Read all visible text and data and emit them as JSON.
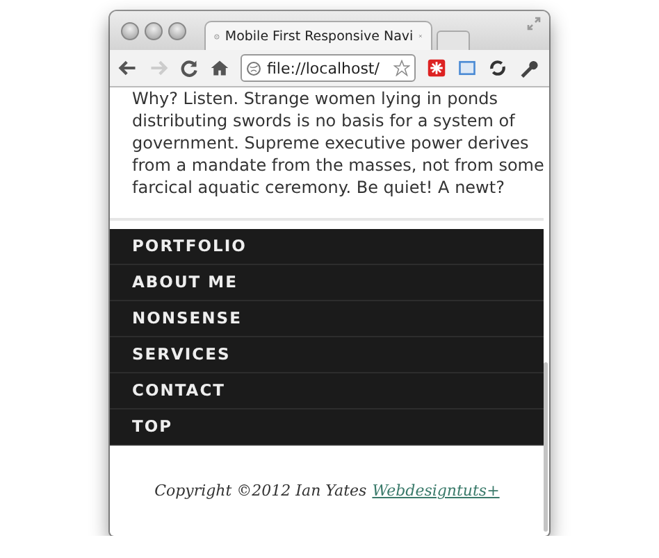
{
  "window": {
    "tab_title": "Mobile First Responsive Navi",
    "address": "file://localhost/"
  },
  "article": {
    "lines": [
      "Why? Listen. Strange women lying in ponds",
      "distributing swords is no basis for a system of",
      "government. Supreme executive power derives",
      "from a mandate from the masses, not from some",
      "farcical aquatic ceremony. Be quiet! A newt?"
    ]
  },
  "nav": {
    "items": [
      {
        "label": "PORTFOLIO"
      },
      {
        "label": "ABOUT ME"
      },
      {
        "label": "NONSENSE"
      },
      {
        "label": "SERVICES"
      },
      {
        "label": "CONTACT"
      },
      {
        "label": "TOP"
      }
    ]
  },
  "footer": {
    "copyright": "Copyright ©2012 Ian Yates",
    "link": "Webdesigntuts+"
  }
}
